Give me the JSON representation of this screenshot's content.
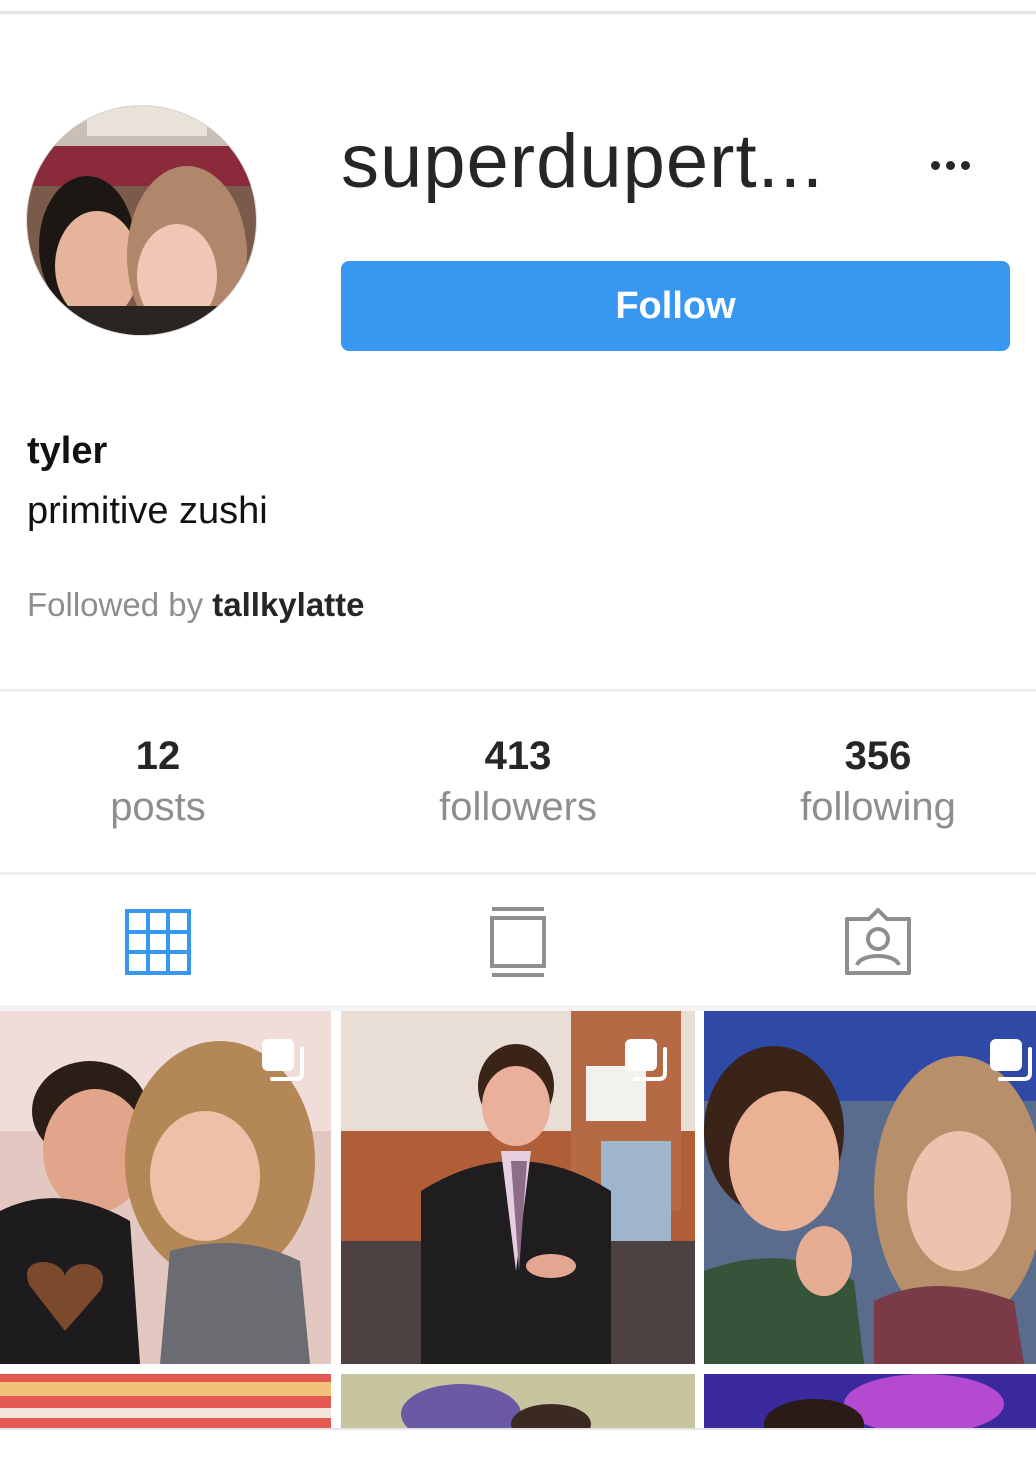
{
  "profile": {
    "username": "superdupert...",
    "follow_label": "Follow",
    "display_name": "tyler",
    "bio": "primitive zushi",
    "followed_by_prefix": "Followed by",
    "followed_by_user": "tallkylatte"
  },
  "stats": [
    {
      "value": "12",
      "label": "posts"
    },
    {
      "value": "413",
      "label": "followers"
    },
    {
      "value": "356",
      "label": "following"
    }
  ],
  "tabs": [
    {
      "icon": "grid-icon",
      "active": true
    },
    {
      "icon": "feed-icon",
      "active": false
    },
    {
      "icon": "tagged-icon",
      "active": false
    }
  ],
  "colors": {
    "accent": "#3897f0",
    "text": "#262626",
    "muted": "#8e8e8e",
    "divider": "#efefef"
  }
}
